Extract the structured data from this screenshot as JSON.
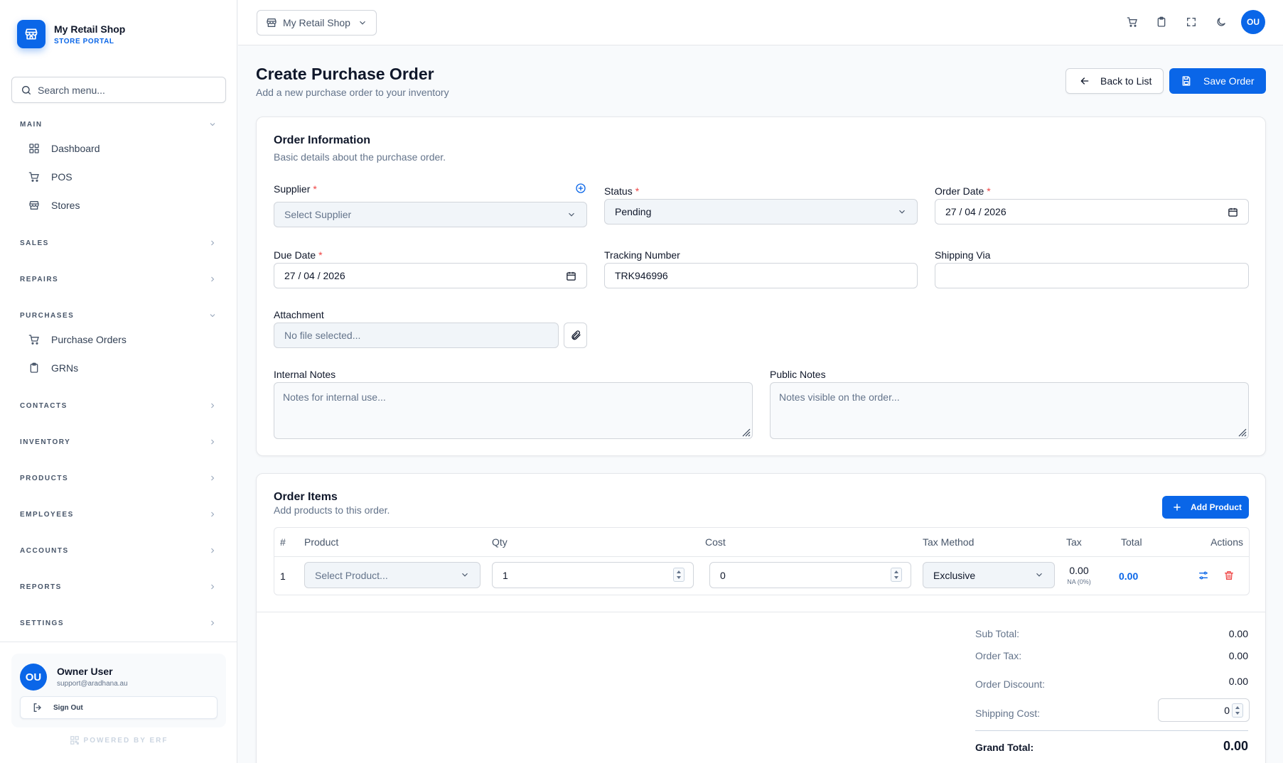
{
  "brand": {
    "name": "My Retail Shop",
    "subtitle": "STORE PORTAL"
  },
  "sidebar": {
    "search_placeholder": "Search menu...",
    "sections": {
      "main": "MAIN",
      "sales": "SALES",
      "repairs": "REPAIRS",
      "purchases": "PURCHASES",
      "contacts": "CONTACTS",
      "inventory": "INVENTORY",
      "products": "PRODUCTS",
      "employees": "EMPLOYEES",
      "accounts": "ACCOUNTS",
      "reports": "REPORTS",
      "settings": "SETTINGS"
    },
    "items": {
      "dashboard": "Dashboard",
      "pos": "POS",
      "stores": "Stores",
      "purchase_orders": "Purchase Orders",
      "grns": "GRNs"
    },
    "user": {
      "initials": "OU",
      "name": "Owner User",
      "email": "support@aradhana.au",
      "signout": "Sign Out"
    },
    "powered": "POWERED BY ERF"
  },
  "topbar": {
    "store": "My Retail Shop",
    "avatar": "OU"
  },
  "page": {
    "title": "Create Purchase Order",
    "subtitle": "Add a new purchase order to your inventory",
    "back_label": "Back to List",
    "save_label": "Save Order"
  },
  "order_info": {
    "title": "Order Information",
    "subtitle": "Basic details about the purchase order.",
    "supplier_label": "Supplier",
    "supplier_placeholder": "Select Supplier",
    "status_label": "Status",
    "status_value": "Pending",
    "order_date_label": "Order Date",
    "order_date_value": "27 / 04 / 2026",
    "due_date_label": "Due Date",
    "due_date_value": "27 / 04 / 2026",
    "tracking_label": "Tracking Number",
    "tracking_value": "TRK946996",
    "shipping_via_label": "Shipping Via",
    "shipping_via_value": "",
    "attachment_label": "Attachment",
    "attachment_placeholder": "No file selected...",
    "internal_notes_label": "Internal Notes",
    "internal_notes_placeholder": "Notes for internal use...",
    "public_notes_label": "Public Notes",
    "public_notes_placeholder": "Notes visible on the order..."
  },
  "order_items": {
    "title": "Order Items",
    "subtitle": "Add products to this order.",
    "add_label": "Add Product",
    "columns": [
      "#",
      "Product",
      "Qty",
      "Cost",
      "Tax Method",
      "Tax",
      "Total",
      "Actions"
    ],
    "rows": [
      {
        "index": "1",
        "product_placeholder": "Select Product...",
        "qty": "1",
        "cost": "0",
        "tax_method": "Exclusive",
        "tax": "0.00",
        "tax_note": "NA (0%)",
        "total": "0.00"
      }
    ]
  },
  "summary": {
    "subtotal_label": "Sub Total:",
    "subtotal": "0.00",
    "order_tax_label": "Order Tax:",
    "order_tax": "0.00",
    "discount_label": "Order Discount:",
    "discount": "0.00",
    "shipping_label": "Shipping Cost:",
    "shipping": "0",
    "grand_total_label": "Grand Total:",
    "grand_total": "0.00"
  },
  "colors": {
    "accent": "#0a66e8",
    "danger": "#ef4444"
  }
}
